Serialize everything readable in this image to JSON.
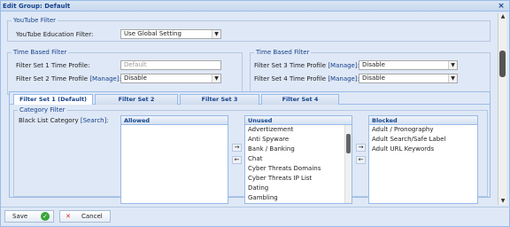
{
  "window": {
    "title": "Edit Group: Default",
    "close_icon": "×"
  },
  "youtube": {
    "legend": "YouTube Filter",
    "label": "YouTube Education Filter:",
    "value": "Use Global Setting"
  },
  "time_left": {
    "legend": "Time Based Filter",
    "set1_label": "Filter Set 1 Time Profile:",
    "set1_placeholder": "Default",
    "set2_label": "Filter Set 2 Time Profile",
    "set2_manage": "[Manage]:",
    "set2_value": "Disable"
  },
  "time_right": {
    "legend": "Time Based Filter",
    "set3_label": "Filter Set 3 Time Profile",
    "set3_manage": "[Manage]:",
    "set3_value": "Disable",
    "set4_label": "Filter Set 4 Time Profile",
    "set4_manage": "[Manage]:",
    "set4_value": "Disable"
  },
  "tabs": [
    "Filter Set 1 (Default)",
    "Filter Set 2",
    "Filter Set 3",
    "Filter Set 4"
  ],
  "category": {
    "legend": "Category Filter",
    "label": "Black List Category",
    "search": "[Search]:",
    "allowed_header": "Allowed",
    "unused_header": "Unused",
    "blocked_header": "Blocked",
    "unused_items": [
      "Advertizement",
      "Anti Spyware",
      "Bank / Banking",
      "Chat",
      "Cyber Threats Domains",
      "Cyber Threats IP List",
      "Dating",
      "Gambling"
    ],
    "blocked_items": [
      "Adult / Pronography",
      "Adult Search/Safe Label",
      "Adult URL Keywords"
    ]
  },
  "footer": {
    "save": "Save",
    "cancel": "Cancel"
  }
}
